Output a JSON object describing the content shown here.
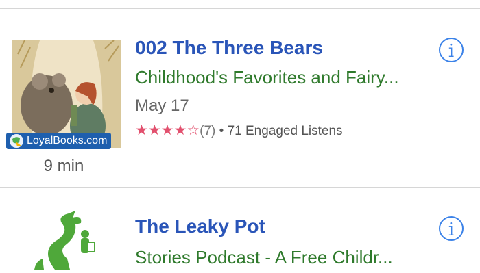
{
  "episodes": [
    {
      "title": "002  The Three Bears",
      "subtitle": "Childhood's Favorites and Fairy...",
      "date": "May 17",
      "stars_filled": "★★★★",
      "stars_empty": "☆",
      "rating_count": "(7)",
      "engagement": "• 71 Engaged Listens",
      "badge": "LoyalBooks.com",
      "duration": "9 min",
      "info": "i"
    },
    {
      "title": "The Leaky Pot",
      "subtitle": "Stories Podcast - A Free Childr...",
      "info": "i"
    }
  ],
  "colors": {
    "title": "#2a55b8",
    "subtitle": "#2f7a2c",
    "stars": "#e2506e",
    "info": "#3b82e8"
  }
}
